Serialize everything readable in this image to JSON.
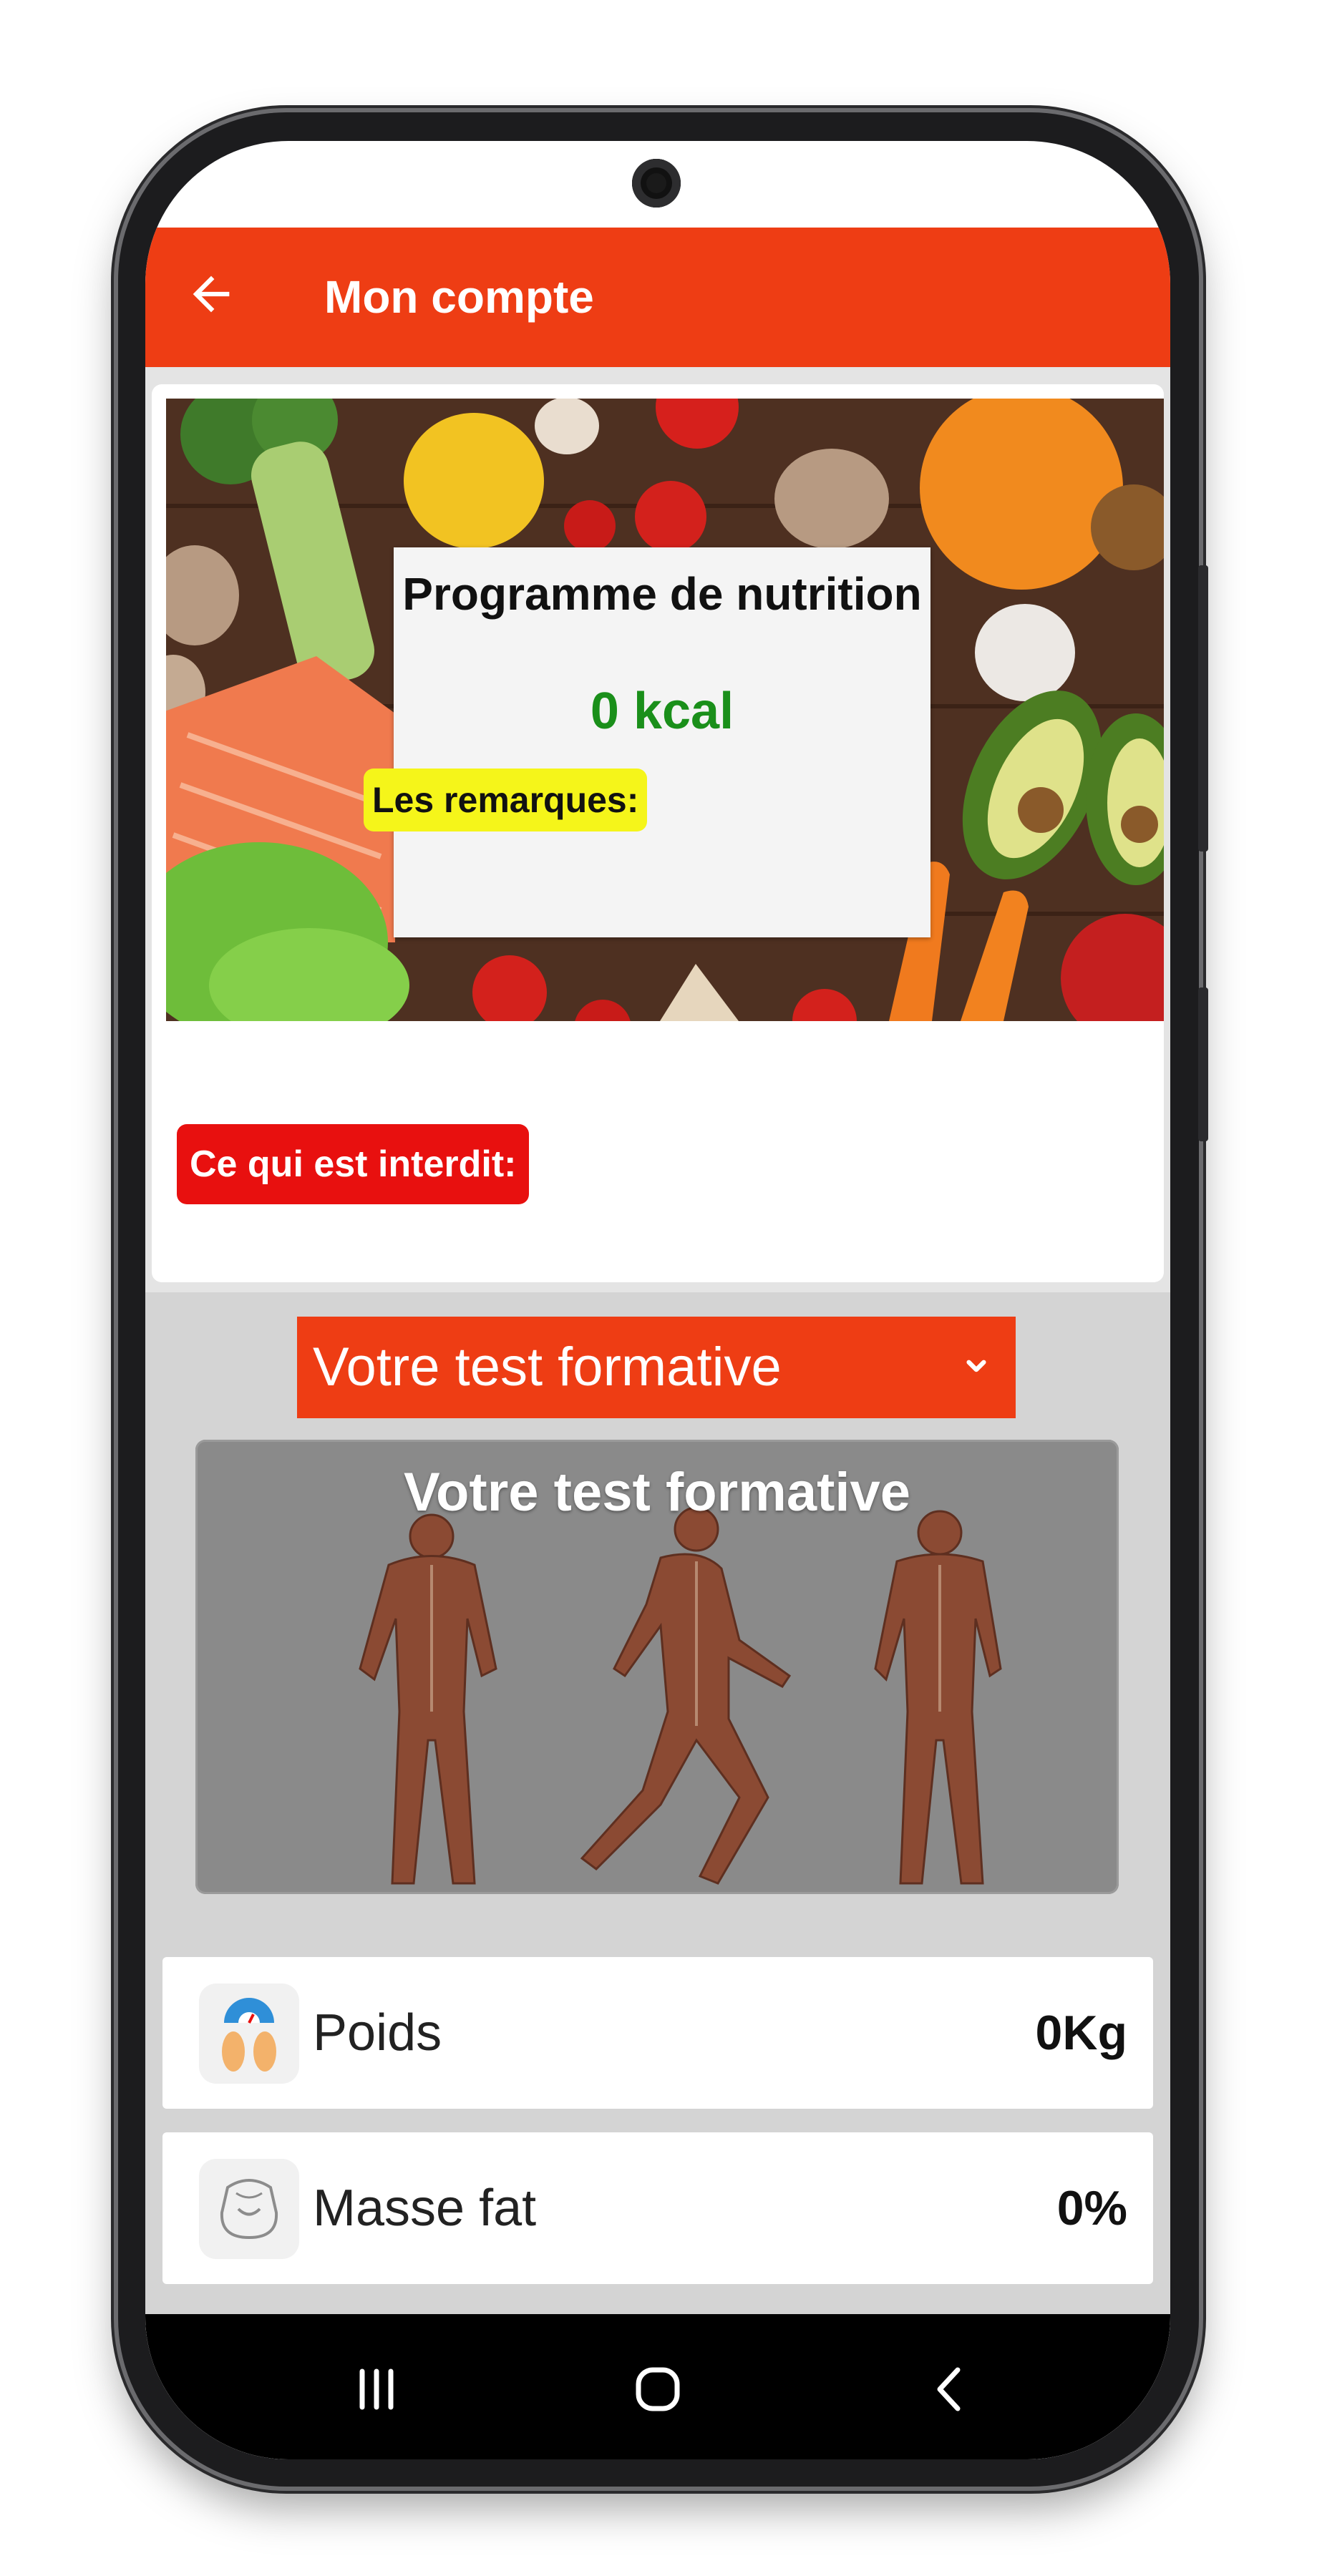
{
  "appbar": {
    "title": "Mon compte",
    "back_icon": "arrow-left-icon"
  },
  "nutrition_card": {
    "title": "Programme de nutrition",
    "calories": "0 kcal",
    "remarks_label": "Les remarques:",
    "forbidden_label": "Ce qui est interdit:"
  },
  "test_section": {
    "dropdown_selected": "Votre test formative",
    "dropdown_icon": "chevron-down-icon",
    "image_title": "Votre test formative"
  },
  "metrics": [
    {
      "label": "Poids",
      "value": "0Kg",
      "icon": "scale-feet-icon"
    },
    {
      "label": "Masse fat",
      "value": "0%",
      "icon": "body-fat-icon"
    }
  ],
  "navbar": {
    "recents_icon": "recents-icon",
    "home_icon": "home-icon",
    "back_icon": "back-icon"
  },
  "colors": {
    "accent": "#ee3d14",
    "remarks_highlight": "#f5f51a",
    "forbidden_badge": "#e8100f",
    "kcal_text": "#1a8f1a"
  }
}
